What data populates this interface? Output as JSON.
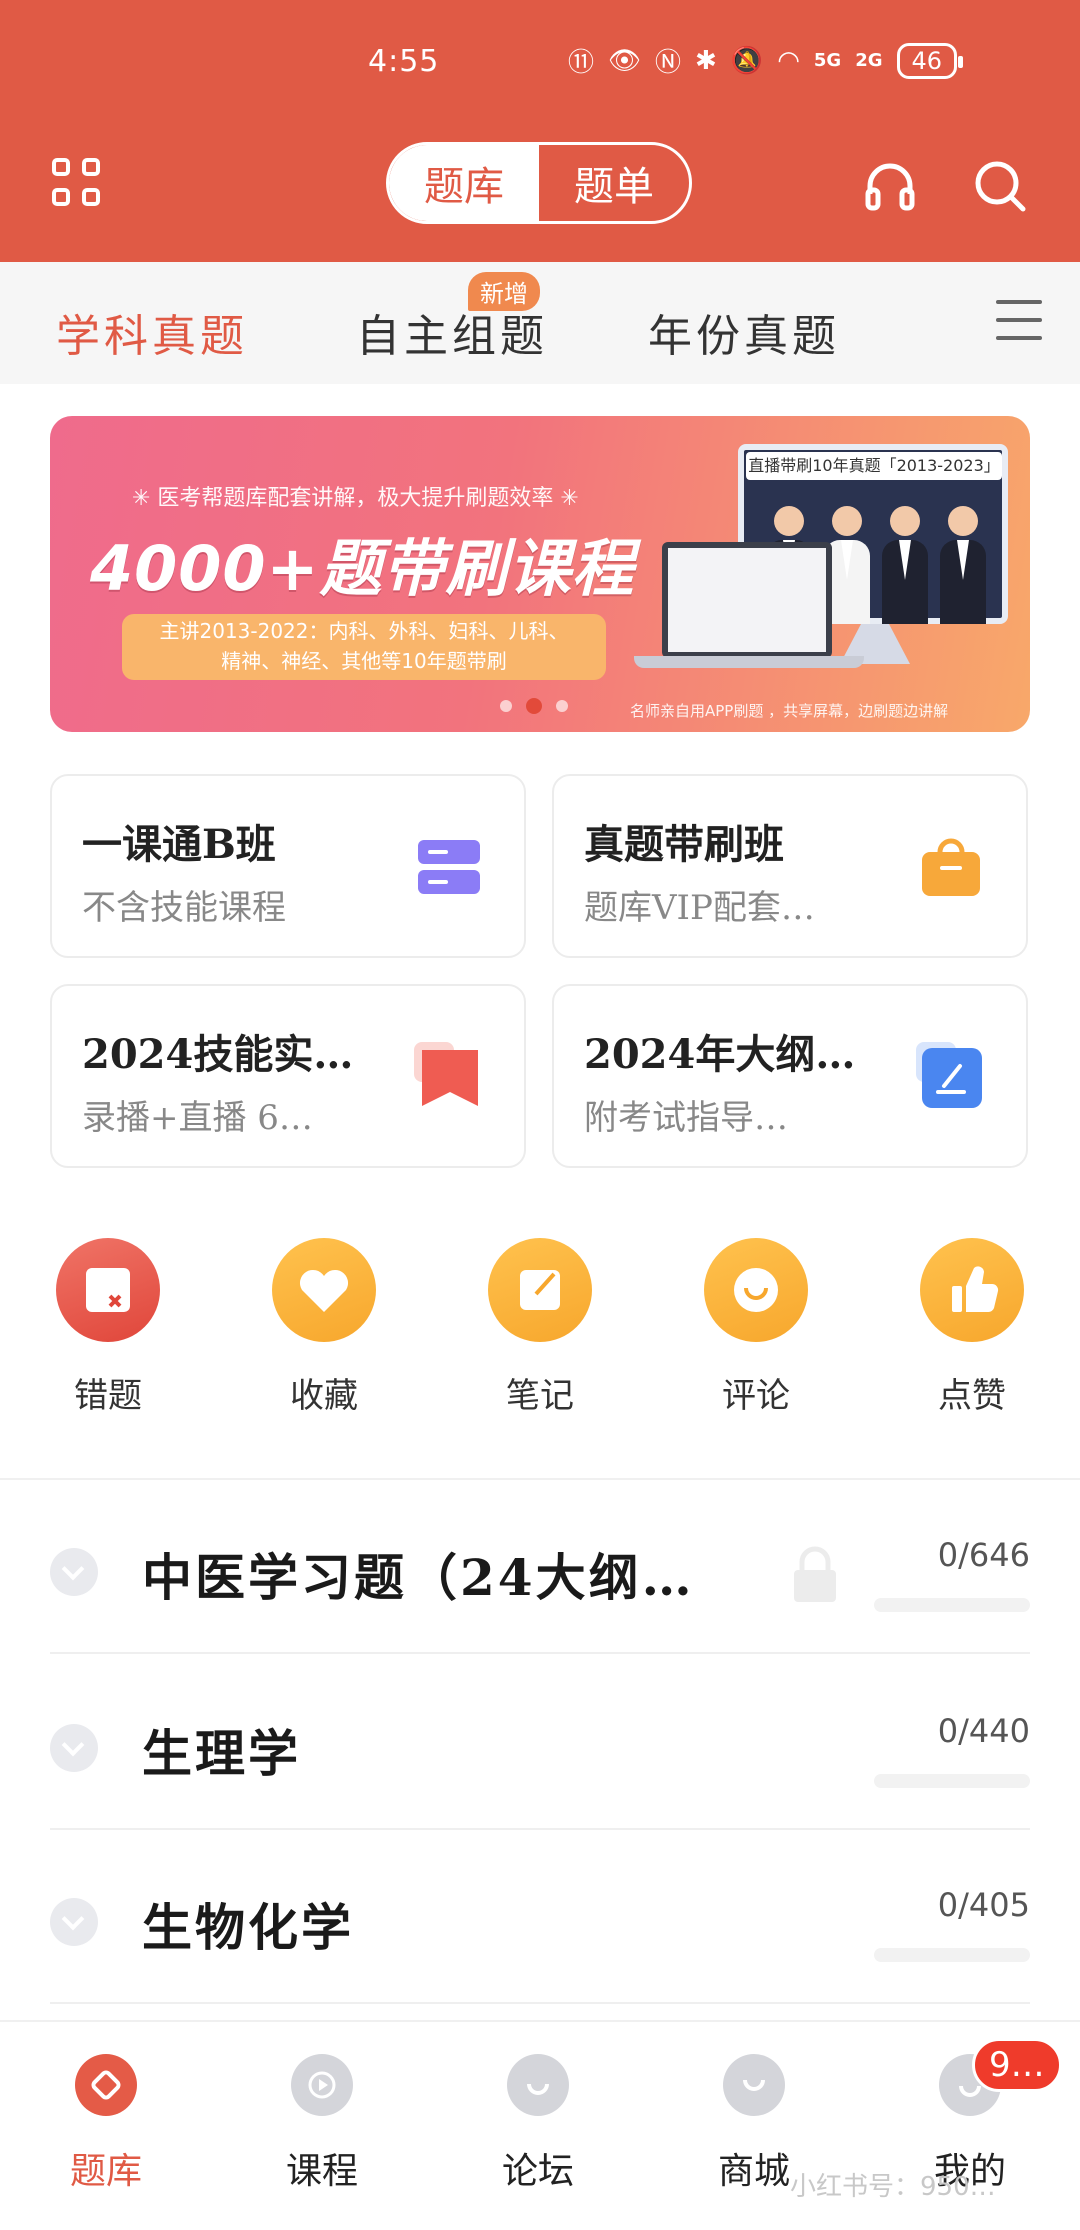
{
  "status_bar": {
    "time": "4:55",
    "battery": "46",
    "signal_labels": [
      "5G",
      "2G"
    ]
  },
  "header": {
    "segments": [
      "题库",
      "题单"
    ],
    "active_segment": 0
  },
  "category_tabs": {
    "items": [
      "学科真题",
      "自主组题",
      "年份真题"
    ],
    "active": 0,
    "new_badge": "新增"
  },
  "banner": {
    "subtitle": "✳ 医考帮题库配套讲解，极大提升刷题效率 ✳",
    "title": "4000+题带刷课程",
    "pill_line1": "主讲2013-2022：内科、外科、妇科、儿科、",
    "pill_line2": "精神、神经、其他等10年题带刷",
    "monitor_title": "直播带刷10年真题「2013-2023」",
    "footer": "名师亲自用APP刷题 ，共享屏幕，边刷题边讲解",
    "slide_count": 3,
    "current_slide": 1
  },
  "cards": [
    {
      "title": "一课通B班",
      "subtitle": "不含技能课程",
      "icon": "server-stack-icon",
      "color": "#8b7cf6"
    },
    {
      "title": "真题带刷班",
      "subtitle": "题库VIP配套…",
      "icon": "shopping-bag-icon",
      "color": "#f7a83a"
    },
    {
      "title": "2024技能实…",
      "subtitle": "录播+直播 6…",
      "icon": "bookmark-icon",
      "color": "#ef5c52"
    },
    {
      "title": "2024年大纲…",
      "subtitle": "附考试指导…",
      "icon": "edit-note-icon",
      "color": "#4a86f0"
    }
  ],
  "tools": [
    {
      "label": "错题",
      "icon": "wrong-question-icon"
    },
    {
      "label": "收藏",
      "icon": "heart-icon"
    },
    {
      "label": "笔记",
      "icon": "note-edit-icon"
    },
    {
      "label": "评论",
      "icon": "comment-icon"
    },
    {
      "label": "点赞",
      "icon": "thumbs-up-icon"
    }
  ],
  "subjects": [
    {
      "title": "中医学习题（24大纲…",
      "count": "0/646",
      "locked": true
    },
    {
      "title": "生理学",
      "count": "0/440",
      "locked": false
    },
    {
      "title": "生物化学",
      "count": "0/405",
      "locked": false
    }
  ],
  "bottom_nav": {
    "items": [
      "题库",
      "课程",
      "论坛",
      "商城",
      "我的"
    ],
    "active": 0,
    "badge": "9…"
  },
  "watermark": "小红书号：950…",
  "colors": {
    "primary": "#e05a45",
    "orange": "#f7a72d",
    "muted": "#888888"
  }
}
